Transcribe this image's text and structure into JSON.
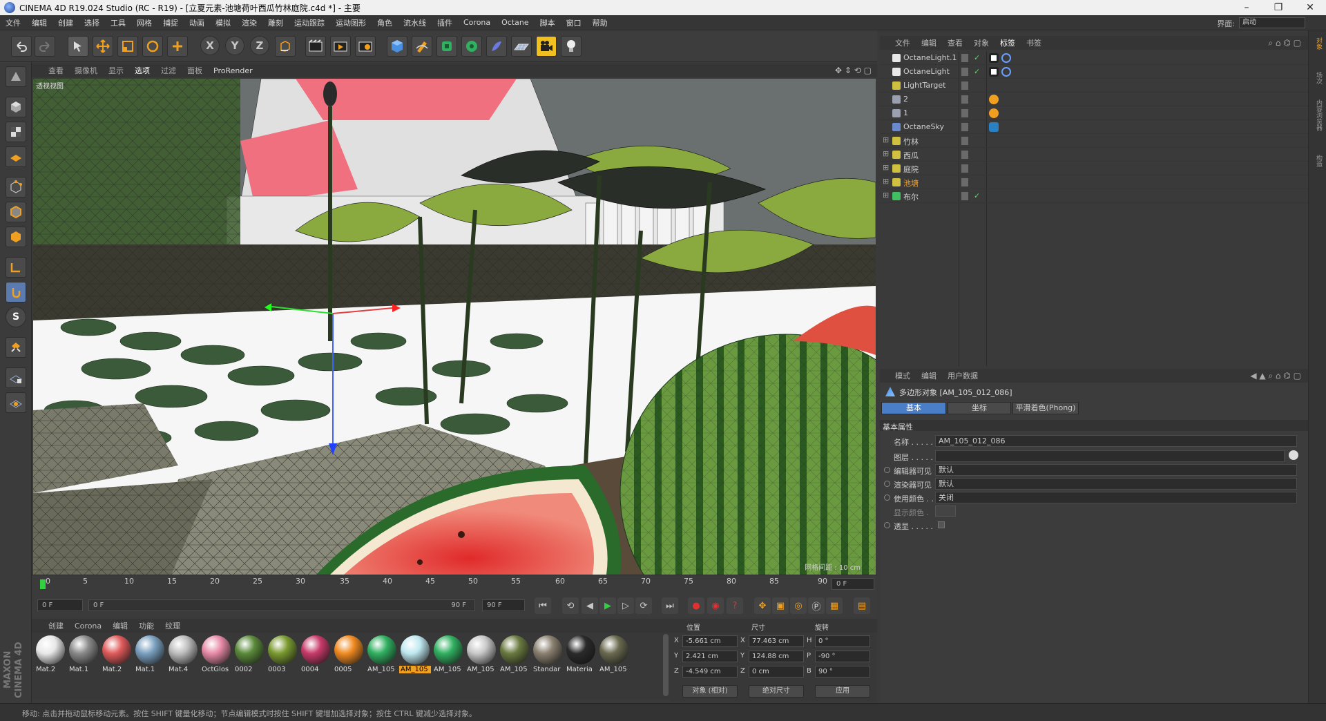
{
  "window": {
    "title": "CINEMA 4D R19.024 Studio (RC - R19) - [立夏元素-池塘荷叶西瓜竹林庭院.c4d *] - 主要"
  },
  "menu": [
    "文件",
    "编辑",
    "创建",
    "选择",
    "工具",
    "网格",
    "捕捉",
    "动画",
    "模拟",
    "渲染",
    "雕刻",
    "运动跟踪",
    "运动图形",
    "角色",
    "流水线",
    "插件",
    "Corona",
    "Octane",
    "脚本",
    "窗口",
    "帮助"
  ],
  "layout": {
    "label": "界面:",
    "value": "启动"
  },
  "toolbar": {
    "axis_x": "X",
    "axis_y": "Y",
    "axis_z": "Z",
    "icons": [
      "undo-icon",
      "redo-icon",
      "select-arrow-icon",
      "move-icon",
      "scale-icon",
      "rotate-icon",
      "add-icon",
      "x-axis-icon",
      "y-axis-icon",
      "z-axis-icon",
      "coord-system-icon",
      "render-view-icon",
      "render-picture-icon",
      "render-settings-icon",
      "cube-icon",
      "pen-icon",
      "subdivision-icon",
      "array-icon",
      "deformer-icon",
      "floor-icon",
      "camera-icon",
      "light-icon"
    ]
  },
  "viewport": {
    "menu": [
      "查看",
      "摄像机",
      "显示",
      "选项",
      "过滤",
      "面板",
      "ProRender"
    ],
    "label": "透视视图",
    "grid_info": "网格间距 : 10 cm"
  },
  "timeline": {
    "ticks": [
      "0",
      "5",
      "10",
      "15",
      "20",
      "25",
      "30",
      "35",
      "40",
      "45",
      "50",
      "55",
      "60",
      "65",
      "70",
      "75",
      "80",
      "85",
      "90"
    ],
    "current_frame": "0 F",
    "start_field": "0 F",
    "range_start": "0 F",
    "range_end": "90 F",
    "end_field": "90 F"
  },
  "materials": {
    "menu": [
      "创建",
      "Corona",
      "编辑",
      "功能",
      "纹理"
    ],
    "items": [
      {
        "name": "Mat.2",
        "color": "#e8e8e8"
      },
      {
        "name": "Mat.1",
        "color": "#8a8a8a"
      },
      {
        "name": "Mat.2",
        "color": "#e05a5a"
      },
      {
        "name": "Mat.1",
        "color": "#7aa0c0"
      },
      {
        "name": "Mat.4",
        "color": "#bdbdbd"
      },
      {
        "name": "OctGlos",
        "color": "#e88aa8"
      },
      {
        "name": "0002",
        "color": "#5a8a3a"
      },
      {
        "name": "0003",
        "color": "#7a9a30"
      },
      {
        "name": "0004",
        "color": "#c83a6a"
      },
      {
        "name": "0005",
        "color": "#f08a20"
      },
      {
        "name": "AM_105",
        "color": "#30b060"
      },
      {
        "name": "AM_105",
        "color": "#bfe8f0"
      },
      {
        "name": "AM_105",
        "color": "#30b060"
      },
      {
        "name": "AM_105",
        "color": "#c8c8c8"
      },
      {
        "name": "AM_105",
        "color": "#6a7a40"
      },
      {
        "name": "Standar",
        "color": "#8a8070"
      },
      {
        "name": "Materia",
        "color": "#2a2a2a"
      },
      {
        "name": "AM_105",
        "color": "#6a6a50"
      }
    ],
    "second_row": [
      {
        "color": "#a09070"
      },
      {
        "color": "#30a040"
      },
      {
        "color": "#3a8a3a"
      },
      {
        "color": "#f0f0f0"
      },
      {
        "color": "#e0e0e0"
      },
      {
        "color": "#1a2a1a"
      },
      {
        "color": "#6a8a50"
      },
      {
        "color": "#5aa040"
      },
      {
        "color": "#d04030"
      }
    ]
  },
  "coords": {
    "headers": [
      "位置",
      "尺寸",
      "旋转"
    ],
    "rows": [
      {
        "axis": "X",
        "pos": "-5.661 cm",
        "size_axis": "X",
        "size": "77.463 cm",
        "rot_axis": "H",
        "rot": "0 °"
      },
      {
        "axis": "Y",
        "pos": "2.421 cm",
        "size_axis": "Y",
        "size": "124.88 cm",
        "rot_axis": "P",
        "rot": "-90 °"
      },
      {
        "axis": "Z",
        "pos": "-4.549 cm",
        "size_axis": "Z",
        "size": "0 cm",
        "rot_axis": "B",
        "rot": "90 °"
      }
    ],
    "mode_select": "对象 (相对)",
    "size_select": "绝对尺寸",
    "apply": "应用"
  },
  "status": "移动: 点击并拖动鼠标移动元素。按住 SHIFT 键量化移动；节点编辑模式时按住 SHIFT 键增加选择对象；按住 CTRL 键减少选择对象。",
  "objects": {
    "menu": [
      "文件",
      "编辑",
      "查看",
      "对象",
      "标签",
      "书签"
    ],
    "rows": [
      {
        "name": "OctaneLight.1",
        "icon_color": "#e8e8e8",
        "name_color": "#d0d0d0"
      },
      {
        "name": "OctaneLight",
        "icon_color": "#e8e8e8",
        "name_color": "#d0d0d0"
      },
      {
        "name": "LightTarget",
        "icon_color": "#d0c040",
        "name_color": "#d0d0d0"
      },
      {
        "name": "2",
        "icon_color": "#9aa0b0",
        "name_color": "#d0d0d0"
      },
      {
        "name": "1",
        "icon_color": "#9aa0b0",
        "name_color": "#d0d0d0"
      },
      {
        "name": "OctaneSky",
        "icon_color": "#6a8ad0",
        "name_color": "#d0d0d0"
      },
      {
        "name": "竹林",
        "icon_color": "#d0c040",
        "name_color": "#d0d0d0"
      },
      {
        "name": "西瓜",
        "icon_color": "#d0c040",
        "name_color": "#d0d0d0"
      },
      {
        "name": "庭院",
        "icon_color": "#d0c040",
        "name_color": "#d0d0d0"
      },
      {
        "name": "池塘",
        "icon_color": "#d0c040",
        "name_color": "#f0a030"
      },
      {
        "name": "布尔",
        "icon_color": "#40c060",
        "name_color": "#d0d0d0"
      }
    ]
  },
  "attributes": {
    "menu": [
      "模式",
      "编辑",
      "用户数据"
    ],
    "object_title": "多边形对象 [AM_105_012_086]",
    "tabs": [
      "基本",
      "坐标",
      "平滑着色(Phong)"
    ],
    "section": "基本属性",
    "fields": [
      {
        "label": "名称 . . . . .",
        "value": "AM_105_012_086"
      },
      {
        "label": "图层 . . . . .",
        "value": ""
      },
      {
        "label": "编辑器可见",
        "value": "默认"
      },
      {
        "label": "渲染器可见",
        "value": "默认"
      },
      {
        "label": "使用颜色 . .",
        "value": "关闭"
      },
      {
        "label": "显示颜色 .",
        "value": ""
      },
      {
        "label": "透显 . . . . .",
        "value": ""
      }
    ]
  },
  "right_strip": [
    "对象",
    "场次",
    "内容浏览器",
    "构造"
  ],
  "accent": "#4a7fc8"
}
